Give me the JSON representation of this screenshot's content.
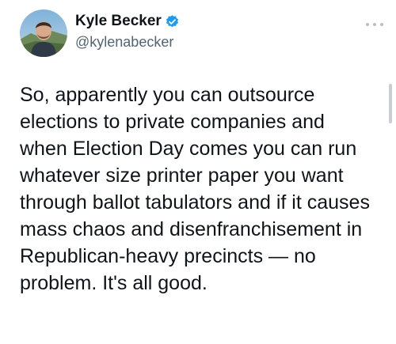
{
  "author": {
    "display_name": "Kyle Becker",
    "handle": "@kylenabecker",
    "verified": true,
    "avatar_icon": "profile-photo",
    "verified_icon": "verified-badge-icon",
    "accent_color": "#1d9bf0"
  },
  "tweet": {
    "text": "So, apparently you can outsource elections to private companies and when Election Day comes you can run whatever size printer paper you want through ballot tabulators and if it causes mass chaos and disenfranchisement in Republican-heavy precincts — no problem. It's all good."
  },
  "menu": {
    "icon": "more-options-icon"
  }
}
